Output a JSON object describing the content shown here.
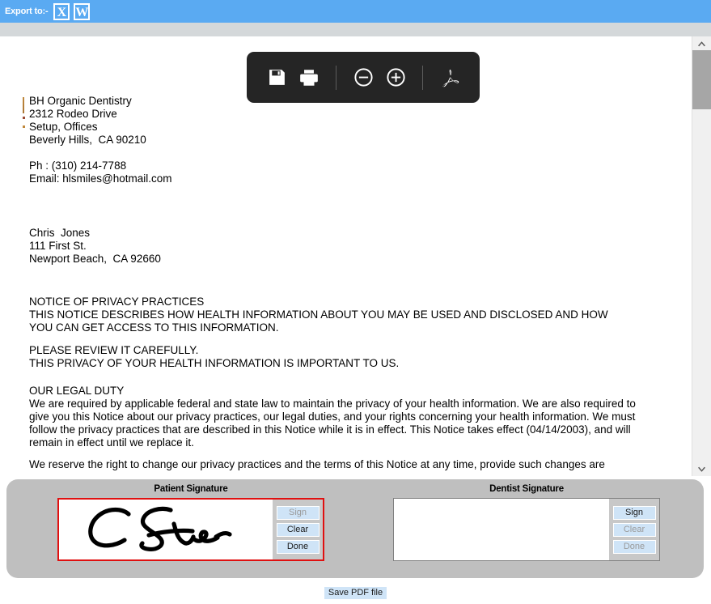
{
  "export_bar": {
    "label": "Export to:-",
    "buttons": [
      {
        "name": "excel",
        "glyph": "X"
      },
      {
        "name": "word",
        "glyph": "W"
      }
    ],
    "background_color": "#5aaaf2"
  },
  "pdf_toolbar": {
    "background_color": "#252525",
    "buttons": [
      {
        "name": "save-icon",
        "tooltip": "Save"
      },
      {
        "name": "print-icon",
        "tooltip": "Print"
      },
      {
        "name": "zoom-out-icon",
        "tooltip": "Zoom out"
      },
      {
        "name": "zoom-in-icon",
        "tooltip": "Zoom in"
      },
      {
        "name": "acrobat-logo-icon",
        "tooltip": "Adobe Acrobat"
      }
    ]
  },
  "document": {
    "practice": "BH Organic Dentistry\n2312 Rodeo Drive\nSetup, Offices\nBeverly Hills,  CA 90210",
    "contact": "Ph : (310) 214-7788\nEmail: hlsmiles@hotmail.com",
    "patient": "Chris  Jones\n111 First St.\nNewport Beach,  CA 92660",
    "notice_heading": "NOTICE OF PRIVACY PRACTICES\nTHIS NOTICE DESCRIBES HOW HEALTH INFORMATION ABOUT YOU MAY BE USED AND DISCLOSED AND HOW\nYOU CAN GET ACCESS TO THIS INFORMATION.",
    "notice_review": "PLEASE REVIEW IT CAREFULLY.\nTHIS PRIVACY OF YOUR HEALTH INFORMATION IS IMPORTANT TO US.",
    "legal_heading": "OUR LEGAL DUTY",
    "legal_body": "We are required by applicable federal and state law to maintain the privacy of your health information. We are also required to give you this Notice about our privacy practices, our legal duties, and your rights concerning your health information. We must follow the privacy practices that are described in this Notice while it is in effect. This Notice takes effect (04/14/2003), and will remain in effect until we replace it.",
    "legal_continued": "We reserve the right to change our privacy practices and the terms of this Notice at any time, provide such changes are"
  },
  "scrollbar": {
    "up_arrow": "∧",
    "down_arrow": "∨",
    "thumb_color": "#a6a6a6"
  },
  "signatures": {
    "patient": {
      "title": "Patient Signature",
      "signed": true,
      "border_color": "#e01010",
      "buttons": [
        {
          "label": "Sign",
          "enabled": false
        },
        {
          "label": "Clear",
          "enabled": true
        },
        {
          "label": "Done",
          "enabled": true
        }
      ]
    },
    "dentist": {
      "title": "Dentist Signature",
      "signed": false,
      "border_color": "#808080",
      "buttons": [
        {
          "label": "Sign",
          "enabled": true
        },
        {
          "label": "Clear",
          "enabled": false
        },
        {
          "label": "Done",
          "enabled": false
        }
      ]
    }
  },
  "footer": {
    "save_pdf_label": "Save PDF file",
    "button_color": "#cfe4f7"
  }
}
